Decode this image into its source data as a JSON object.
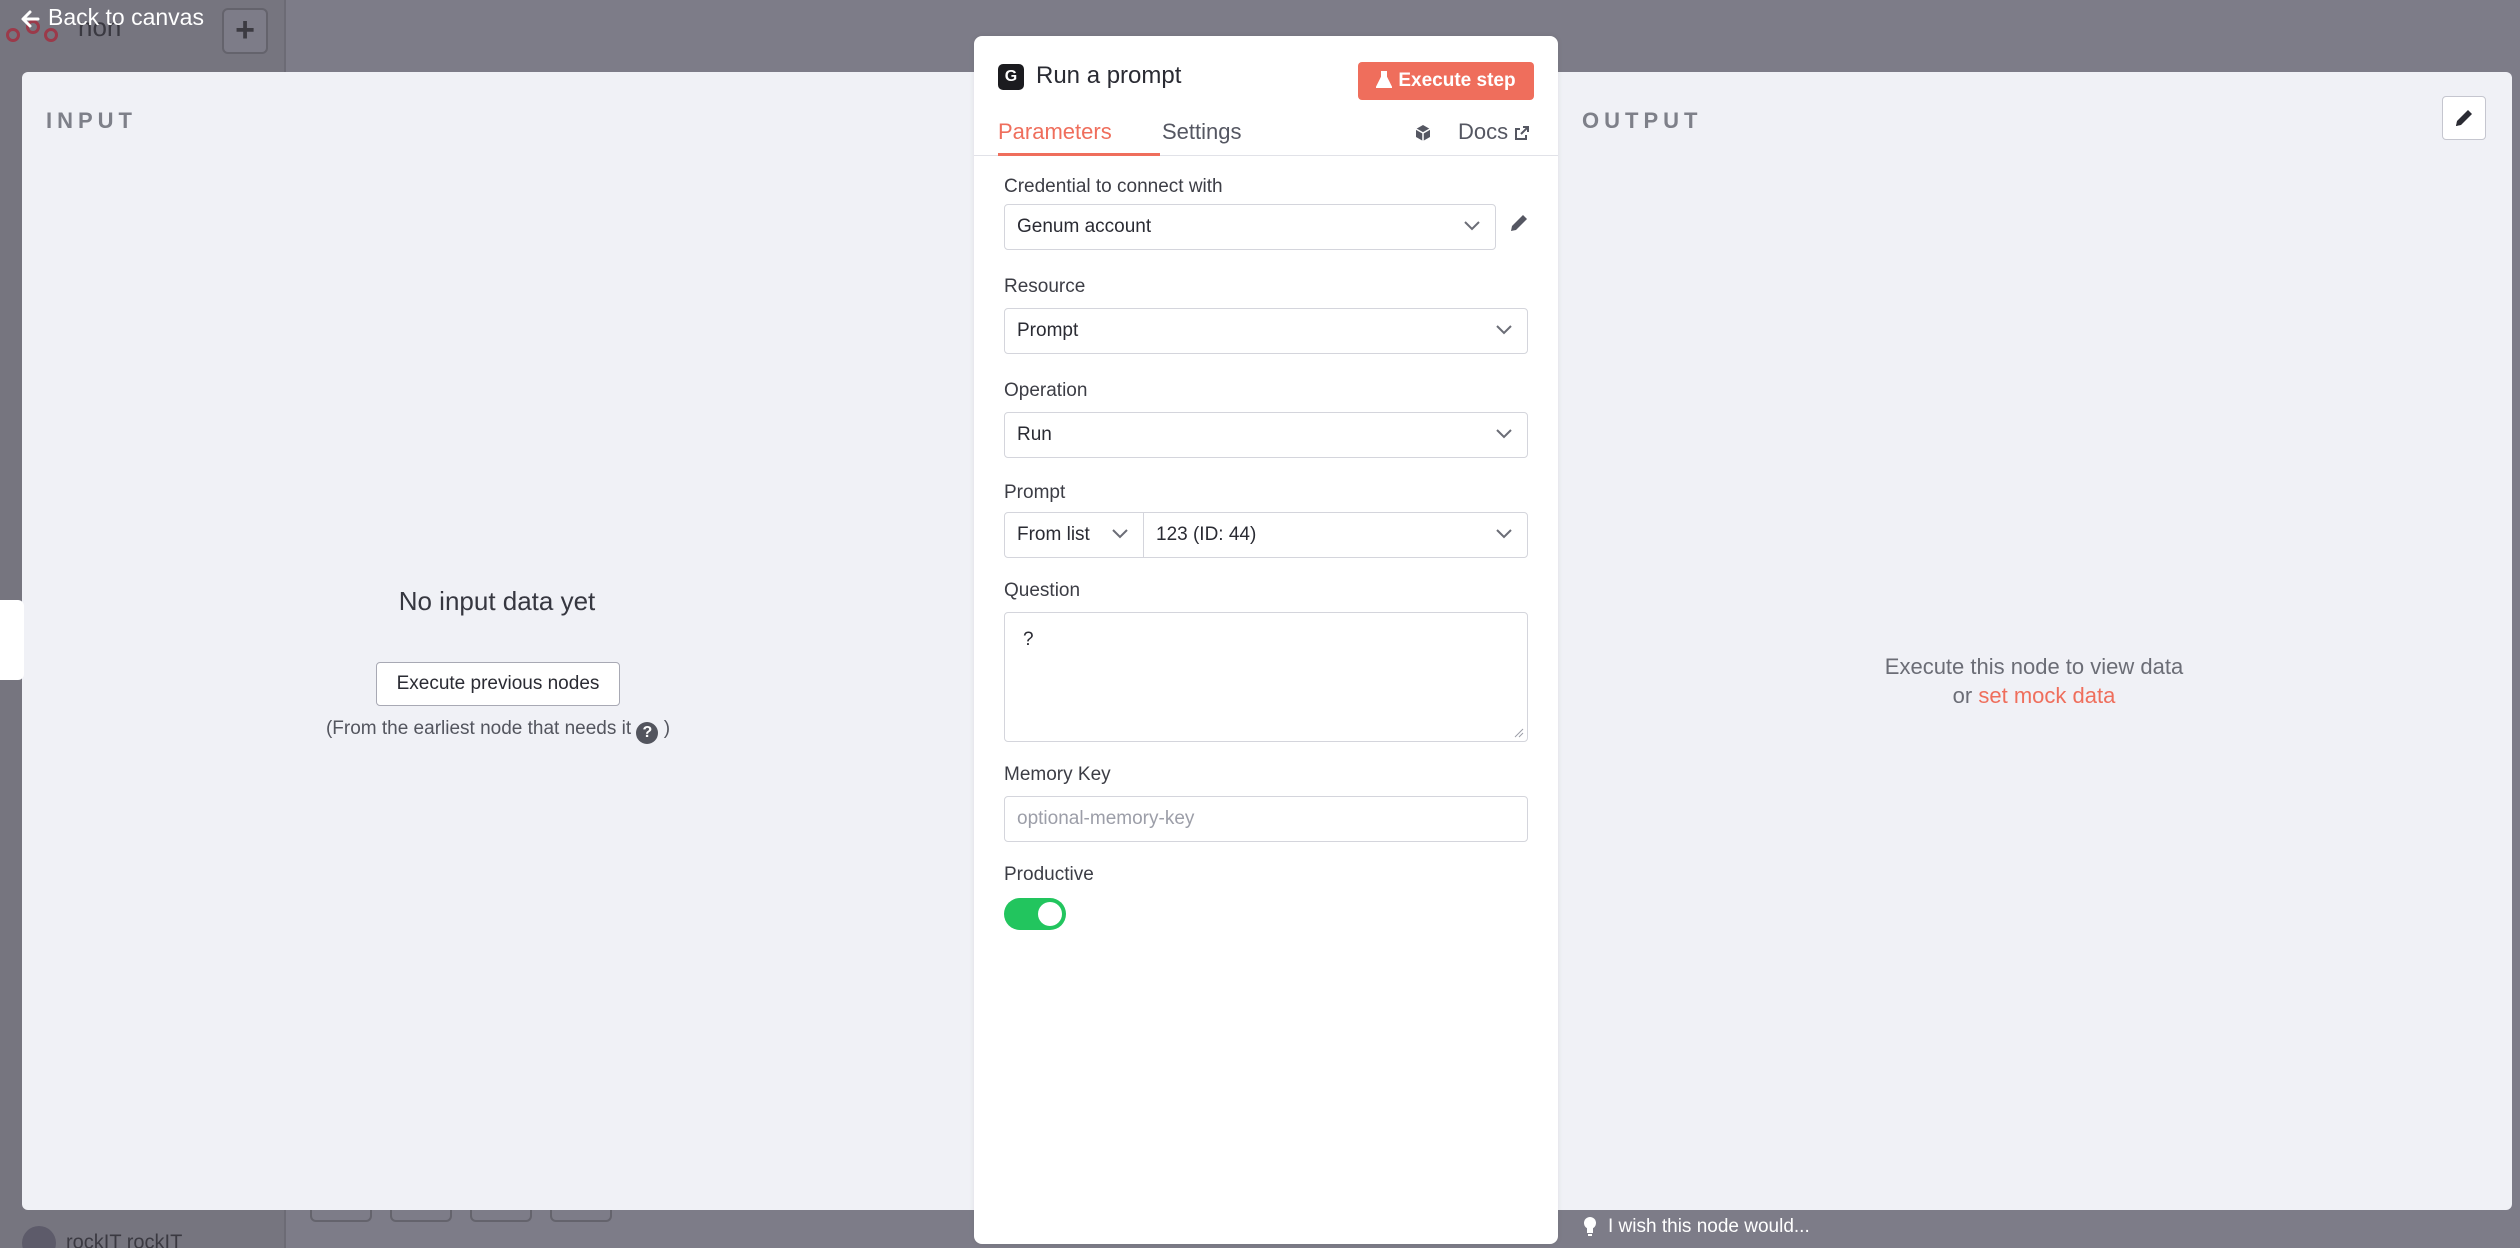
{
  "background": {
    "workflow_name": "non",
    "user_name": "rockIT rockIT"
  },
  "nav": {
    "back_label": "Back to canvas"
  },
  "input_pane": {
    "title": "INPUT",
    "empty_title": "No input data yet",
    "execute_previous_label": "Execute previous nodes",
    "note_prefix": "(From the earliest node that needs it",
    "note_suffix": ")"
  },
  "output_pane": {
    "title": "OUTPUT",
    "message_line1": "Execute this node to view data",
    "message_or": "or",
    "mock_link": "set mock data"
  },
  "feedback": {
    "label": "I wish this node would..."
  },
  "node": {
    "icon_letter": "G",
    "title": "Run a prompt",
    "execute_step_label": "Execute step",
    "tabs": [
      {
        "label": "Parameters",
        "active": true
      },
      {
        "label": "Settings",
        "active": false
      }
    ],
    "docs_label": "Docs",
    "fields": {
      "credential": {
        "label": "Credential to connect with",
        "value": "Genum account"
      },
      "resource": {
        "label": "Resource",
        "value": "Prompt"
      },
      "operation": {
        "label": "Operation",
        "value": "Run"
      },
      "prompt": {
        "label": "Prompt",
        "mode": "From list",
        "value": "123 (ID: 44)"
      },
      "question": {
        "label": "Question",
        "value": "?"
      },
      "memory_key": {
        "label": "Memory Key",
        "placeholder": "optional-memory-key"
      },
      "productive": {
        "label": "Productive",
        "enabled": true
      }
    }
  },
  "colors": {
    "accent": "#ef6e5c",
    "toggle_on": "#22c55e"
  }
}
